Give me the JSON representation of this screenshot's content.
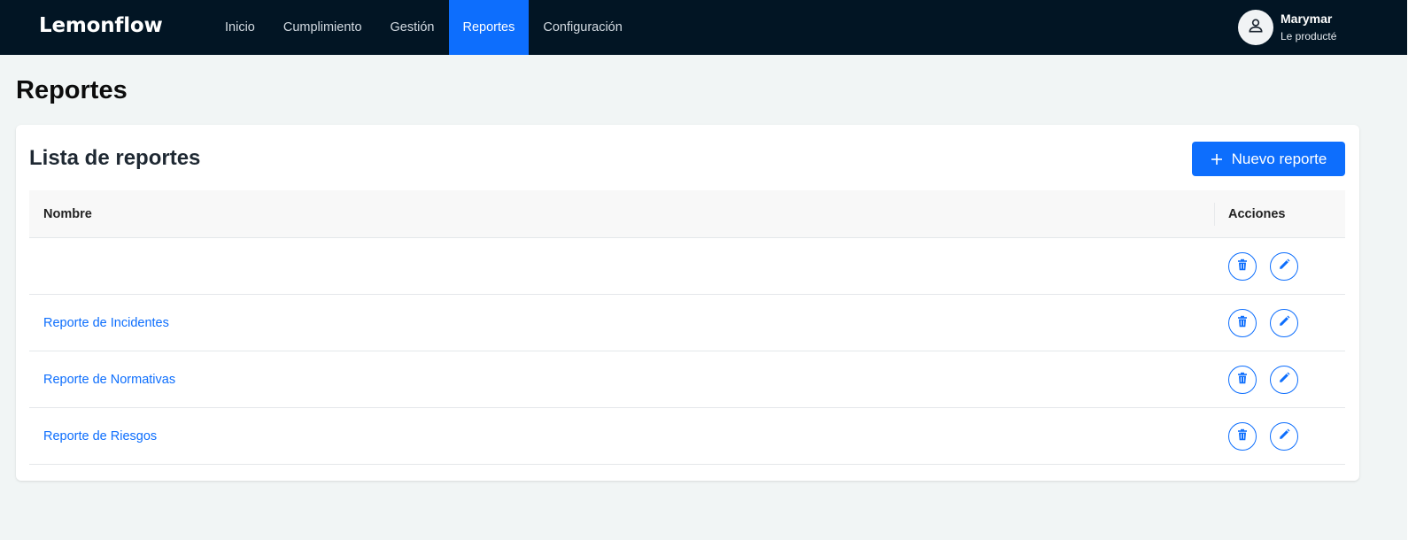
{
  "app": {
    "brand": "Lemonflow"
  },
  "nav": {
    "items": [
      {
        "label": "Inicio",
        "active": false
      },
      {
        "label": "Cumplimiento",
        "active": false
      },
      {
        "label": "Gestión",
        "active": false
      },
      {
        "label": "Reportes",
        "active": true
      },
      {
        "label": "Configuración",
        "active": false
      }
    ]
  },
  "user": {
    "name": "Marymar",
    "role": "Le producté",
    "icon": "user-icon"
  },
  "page": {
    "title": "Reportes"
  },
  "card": {
    "title": "Lista de reportes",
    "new_button": {
      "label": "Nuevo reporte",
      "icon": "plus-icon"
    }
  },
  "table": {
    "columns": {
      "name": "Nombre",
      "actions": "Acciones"
    },
    "rows": [
      {
        "name": ""
      },
      {
        "name": "Reporte de Incidentes"
      },
      {
        "name": "Reporte de Normativas"
      },
      {
        "name": "Reporte de Riesgos"
      }
    ],
    "row_actions": {
      "delete_icon": "trash-icon",
      "edit_icon": "pencil-icon"
    }
  },
  "colors": {
    "topbar": "#021524",
    "accent": "#0d6efd",
    "background": "#f1f5f5"
  }
}
